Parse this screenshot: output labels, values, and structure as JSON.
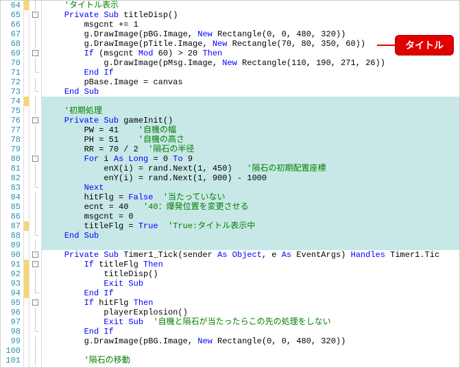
{
  "callout": "タイトル",
  "lines": [
    {
      "n": 64,
      "chg": "y",
      "fold": "line",
      "hl": false,
      "tokens": [
        {
          "c": "cm",
          "t": "    'タイトル表示"
        }
      ]
    },
    {
      "n": 65,
      "chg": "",
      "fold": "box",
      "hl": false,
      "tokens": [
        {
          "c": "kw",
          "t": "    Private Sub"
        },
        {
          "c": "txt",
          "t": " titleDisp()"
        }
      ]
    },
    {
      "n": 66,
      "chg": "",
      "fold": "line",
      "hl": false,
      "tokens": [
        {
          "c": "txt",
          "t": "        msgcnt += 1"
        }
      ]
    },
    {
      "n": 67,
      "chg": "",
      "fold": "line",
      "hl": false,
      "tokens": [
        {
          "c": "txt",
          "t": "        g.DrawImage(pBG.Image, "
        },
        {
          "c": "kw",
          "t": "New"
        },
        {
          "c": "txt",
          "t": " Rectangle(0, 0, 480, 320))"
        }
      ]
    },
    {
      "n": 68,
      "chg": "",
      "fold": "line",
      "hl": false,
      "tokens": [
        {
          "c": "txt",
          "t": "        g.DrawImage(pTitle.Image, "
        },
        {
          "c": "kw",
          "t": "New"
        },
        {
          "c": "txt",
          "t": " Rectangle(70, 80, 350, 60))"
        }
      ]
    },
    {
      "n": 69,
      "chg": "",
      "fold": "box",
      "hl": false,
      "tokens": [
        {
          "c": "txt",
          "t": "        "
        },
        {
          "c": "kw",
          "t": "If"
        },
        {
          "c": "txt",
          "t": " (msgcnt "
        },
        {
          "c": "kw",
          "t": "Mod"
        },
        {
          "c": "txt",
          "t": " 60) > 20 "
        },
        {
          "c": "kw",
          "t": "Then"
        }
      ]
    },
    {
      "n": 70,
      "chg": "",
      "fold": "line",
      "hl": false,
      "tokens": [
        {
          "c": "txt",
          "t": "            g.DrawImage(pMsg.Image, "
        },
        {
          "c": "kw",
          "t": "New"
        },
        {
          "c": "txt",
          "t": " Rectangle(110, 190, 271, 26))"
        }
      ]
    },
    {
      "n": 71,
      "chg": "",
      "fold": "end",
      "hl": false,
      "tokens": [
        {
          "c": "txt",
          "t": "        "
        },
        {
          "c": "kw",
          "t": "End If"
        }
      ]
    },
    {
      "n": 72,
      "chg": "",
      "fold": "line",
      "hl": false,
      "tokens": [
        {
          "c": "txt",
          "t": "        pBase.Image = canvas"
        }
      ]
    },
    {
      "n": 73,
      "chg": "",
      "fold": "end",
      "hl": false,
      "tokens": [
        {
          "c": "txt",
          "t": "    "
        },
        {
          "c": "kw",
          "t": "End Sub"
        }
      ]
    },
    {
      "n": 74,
      "chg": "y",
      "fold": "line",
      "hl": true,
      "tokens": [
        {
          "c": "txt",
          "t": ""
        }
      ]
    },
    {
      "n": 75,
      "chg": "",
      "fold": "line",
      "hl": true,
      "tokens": [
        {
          "c": "cm",
          "t": "    '初期処理"
        }
      ]
    },
    {
      "n": 76,
      "chg": "",
      "fold": "box",
      "hl": true,
      "tokens": [
        {
          "c": "kw",
          "t": "    Private Sub"
        },
        {
          "c": "txt",
          "t": " gameInit()"
        }
      ]
    },
    {
      "n": 77,
      "chg": "",
      "fold": "line",
      "hl": true,
      "tokens": [
        {
          "c": "txt",
          "t": "        PW = 41    "
        },
        {
          "c": "cm",
          "t": "'自機の幅"
        }
      ]
    },
    {
      "n": 78,
      "chg": "",
      "fold": "line",
      "hl": true,
      "tokens": [
        {
          "c": "txt",
          "t": "        PH = 51    "
        },
        {
          "c": "cm",
          "t": "'自機の高さ"
        }
      ]
    },
    {
      "n": 79,
      "chg": "",
      "fold": "line",
      "hl": true,
      "tokens": [
        {
          "c": "txt",
          "t": "        RR = 70 / 2  "
        },
        {
          "c": "cm",
          "t": "'隕石の半径"
        }
      ]
    },
    {
      "n": 80,
      "chg": "",
      "fold": "box",
      "hl": true,
      "tokens": [
        {
          "c": "txt",
          "t": "        "
        },
        {
          "c": "kw",
          "t": "For"
        },
        {
          "c": "txt",
          "t": " i "
        },
        {
          "c": "kw",
          "t": "As Long"
        },
        {
          "c": "txt",
          "t": " = 0 "
        },
        {
          "c": "kw",
          "t": "To"
        },
        {
          "c": "txt",
          "t": " 9"
        }
      ]
    },
    {
      "n": 81,
      "chg": "",
      "fold": "line",
      "hl": true,
      "tokens": [
        {
          "c": "txt",
          "t": "            enX(i) = rand.Next(1, 450)   "
        },
        {
          "c": "cm",
          "t": "'隕石の初期配置座標"
        }
      ]
    },
    {
      "n": 82,
      "chg": "",
      "fold": "line",
      "hl": true,
      "tokens": [
        {
          "c": "txt",
          "t": "            enY(i) = rand.Next(1, 900) - 1000"
        }
      ]
    },
    {
      "n": 83,
      "chg": "",
      "fold": "end",
      "hl": true,
      "tokens": [
        {
          "c": "txt",
          "t": "        "
        },
        {
          "c": "kw",
          "t": "Next"
        }
      ]
    },
    {
      "n": 84,
      "chg": "",
      "fold": "line",
      "hl": true,
      "tokens": [
        {
          "c": "txt",
          "t": "        hitFlg = "
        },
        {
          "c": "kw",
          "t": "False"
        },
        {
          "c": "txt",
          "t": "  "
        },
        {
          "c": "cm",
          "t": "'当たっていない"
        }
      ]
    },
    {
      "n": 85,
      "chg": "",
      "fold": "line",
      "hl": true,
      "tokens": [
        {
          "c": "txt",
          "t": "        ecnt = 40   "
        },
        {
          "c": "cm",
          "t": "'40：爆発位置を変更させる"
        }
      ]
    },
    {
      "n": 86,
      "chg": "",
      "fold": "line",
      "hl": true,
      "tokens": [
        {
          "c": "txt",
          "t": "        msgcnt = 0"
        }
      ]
    },
    {
      "n": 87,
      "chg": "y",
      "fold": "line",
      "hl": true,
      "tokens": [
        {
          "c": "txt",
          "t": "        titleFlg = "
        },
        {
          "c": "kw",
          "t": "True"
        },
        {
          "c": "txt",
          "t": "  "
        },
        {
          "c": "cm",
          "t": "'True:タイトル表示中"
        }
      ]
    },
    {
      "n": 88,
      "chg": "",
      "fold": "end",
      "hl": true,
      "tokens": [
        {
          "c": "txt",
          "t": "    "
        },
        {
          "c": "kw",
          "t": "End Sub"
        }
      ]
    },
    {
      "n": 89,
      "chg": "",
      "fold": "line",
      "hl": true,
      "tokens": [
        {
          "c": "txt",
          "t": ""
        }
      ]
    },
    {
      "n": 90,
      "chg": "",
      "fold": "box",
      "hl": false,
      "tokens": [
        {
          "c": "kw",
          "t": "    Private Sub"
        },
        {
          "c": "txt",
          "t": " Timer1_Tick(sender "
        },
        {
          "c": "kw",
          "t": "As Object"
        },
        {
          "c": "txt",
          "t": ", e "
        },
        {
          "c": "kw",
          "t": "As"
        },
        {
          "c": "txt",
          "t": " EventArgs) "
        },
        {
          "c": "kw",
          "t": "Handles"
        },
        {
          "c": "txt",
          "t": " Timer1.Tic"
        }
      ]
    },
    {
      "n": 91,
      "chg": "y",
      "fold": "box",
      "hl": false,
      "tokens": [
        {
          "c": "txt",
          "t": "        "
        },
        {
          "c": "kw",
          "t": "If"
        },
        {
          "c": "txt",
          "t": " titleFlg "
        },
        {
          "c": "kw",
          "t": "Then"
        }
      ]
    },
    {
      "n": 92,
      "chg": "y",
      "fold": "line",
      "hl": false,
      "tokens": [
        {
          "c": "txt",
          "t": "            titleDisp()"
        }
      ]
    },
    {
      "n": 93,
      "chg": "y",
      "fold": "line",
      "hl": false,
      "tokens": [
        {
          "c": "txt",
          "t": "            "
        },
        {
          "c": "kw",
          "t": "Exit Sub"
        }
      ]
    },
    {
      "n": 94,
      "chg": "y",
      "fold": "end",
      "hl": false,
      "tokens": [
        {
          "c": "txt",
          "t": "        "
        },
        {
          "c": "kw",
          "t": "End If"
        }
      ]
    },
    {
      "n": 95,
      "chg": "",
      "fold": "box",
      "hl": false,
      "tokens": [
        {
          "c": "txt",
          "t": "        "
        },
        {
          "c": "kw",
          "t": "If"
        },
        {
          "c": "txt",
          "t": " hitFlg "
        },
        {
          "c": "kw",
          "t": "Then"
        }
      ]
    },
    {
      "n": 96,
      "chg": "",
      "fold": "line",
      "hl": false,
      "tokens": [
        {
          "c": "txt",
          "t": "            playerExplosion()"
        }
      ]
    },
    {
      "n": 97,
      "chg": "",
      "fold": "line",
      "hl": false,
      "tokens": [
        {
          "c": "txt",
          "t": "            "
        },
        {
          "c": "kw",
          "t": "Exit Sub"
        },
        {
          "c": "txt",
          "t": "  "
        },
        {
          "c": "cm",
          "t": "'自機と隕石が当たったらこの先の処理をしない"
        }
      ]
    },
    {
      "n": 98,
      "chg": "",
      "fold": "end",
      "hl": false,
      "tokens": [
        {
          "c": "txt",
          "t": "        "
        },
        {
          "c": "kw",
          "t": "End If"
        }
      ]
    },
    {
      "n": 99,
      "chg": "",
      "fold": "line",
      "hl": false,
      "tokens": [
        {
          "c": "txt",
          "t": "        g.DrawImage(pBG.Image, "
        },
        {
          "c": "kw",
          "t": "New"
        },
        {
          "c": "txt",
          "t": " Rectangle(0, 0, 480, 320))"
        }
      ]
    },
    {
      "n": 100,
      "chg": "",
      "fold": "line",
      "hl": false,
      "tokens": [
        {
          "c": "txt",
          "t": ""
        }
      ]
    },
    {
      "n": 101,
      "chg": "",
      "fold": "line",
      "hl": false,
      "tokens": [
        {
          "c": "cm",
          "t": "        '隕石の移動"
        }
      ]
    }
  ]
}
